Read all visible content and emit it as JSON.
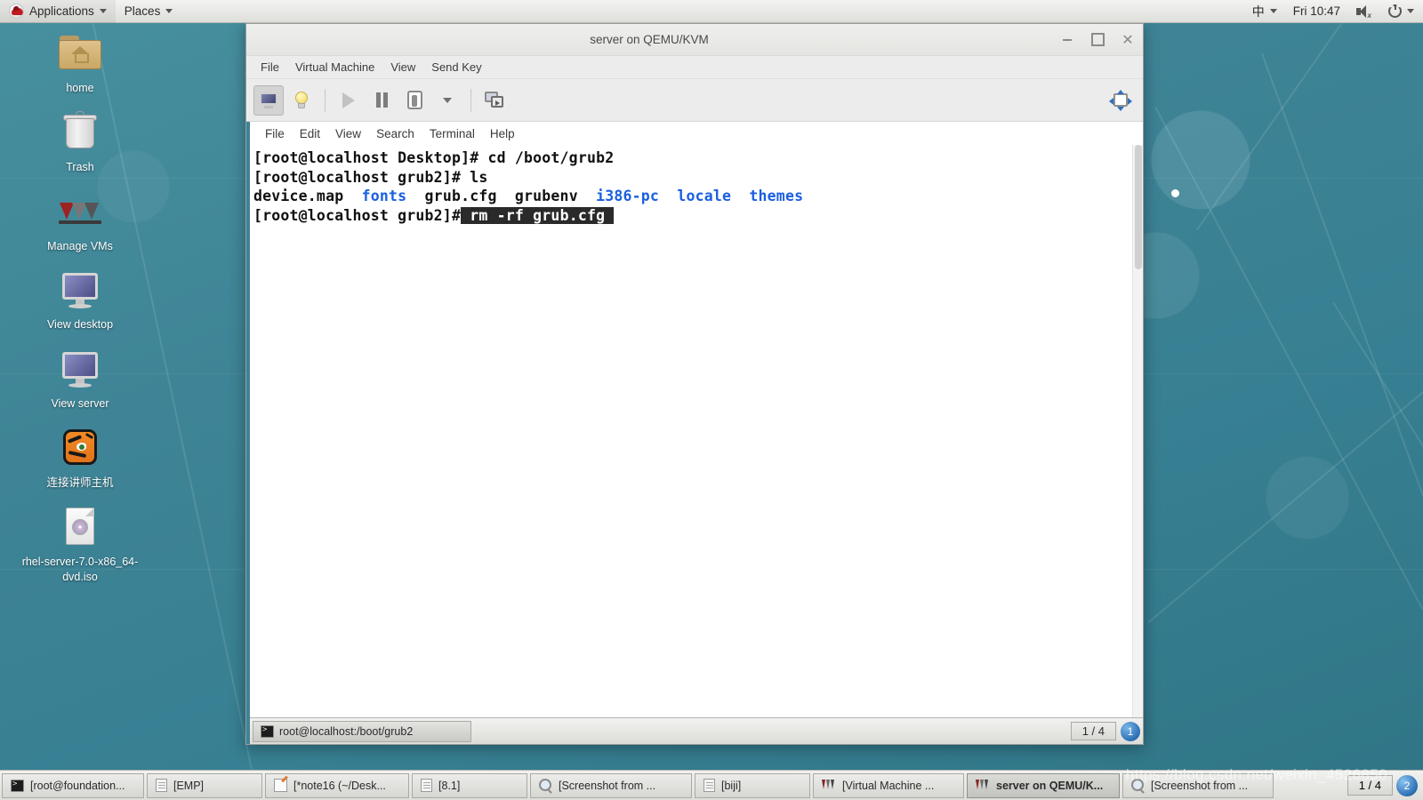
{
  "top_panel": {
    "logo_icon": "redhat-logo-icon",
    "applications_label": "Applications",
    "places_label": "Places",
    "input_method": "中",
    "clock": "Fri 10:47",
    "volume_icon": "volume-muted-icon",
    "power_icon": "power-icon"
  },
  "desktop_icons": [
    {
      "label": "home",
      "icon": "home-folder-icon"
    },
    {
      "label": "Trash",
      "icon": "trash-icon"
    },
    {
      "label": "Manage VMs",
      "icon": "virt-manager-icon"
    },
    {
      "label": "View desktop",
      "icon": "monitor-icon"
    },
    {
      "label": "View server",
      "icon": "monitor-icon"
    },
    {
      "label": "连接讲师主机",
      "icon": "tigervnc-icon"
    },
    {
      "label": "rhel-server-7.0-x86_64-dvd.iso",
      "icon": "iso-disc-icon"
    }
  ],
  "vm_window": {
    "title": "server on QEMU/KVM",
    "window_buttons": {
      "minimize": "_",
      "maximize": "□",
      "close": "✕"
    },
    "menus": [
      "File",
      "Virtual Machine",
      "View",
      "Send Key"
    ],
    "toolbar": [
      {
        "name": "show-console-button",
        "icon": "monitor-icon",
        "state": "active"
      },
      {
        "name": "show-details-button",
        "icon": "lightbulb-icon",
        "state": "enabled"
      },
      {
        "name": "run-button",
        "icon": "play-icon",
        "state": "disabled"
      },
      {
        "name": "pause-button",
        "icon": "pause-icon",
        "state": "enabled"
      },
      {
        "name": "shutdown-button",
        "icon": "shutdown-icon",
        "state": "enabled"
      },
      {
        "name": "shutdown-dropdown",
        "icon": "chevron-down-icon",
        "state": "enabled"
      },
      {
        "name": "snapshots-button",
        "icon": "snapshot-icon",
        "state": "enabled"
      }
    ],
    "fullscreen_icon": "fullscreen-resize-icon"
  },
  "guest": {
    "terminal_menus": [
      "File",
      "Edit",
      "View",
      "Search",
      "Terminal",
      "Help"
    ],
    "lines": [
      [
        {
          "t": "[root@localhost Desktop]# cd /boot/grub2",
          "c": "plain"
        }
      ],
      [
        {
          "t": "[root@localhost grub2]# ls",
          "c": "plain"
        }
      ],
      [
        {
          "t": "device.map  ",
          "c": "plain"
        },
        {
          "t": "fonts",
          "c": "dir"
        },
        {
          "t": "  grub.cfg  grubenv  ",
          "c": "plain"
        },
        {
          "t": "i386-pc",
          "c": "dir"
        },
        {
          "t": "  ",
          "c": "plain"
        },
        {
          "t": "locale",
          "c": "dir"
        },
        {
          "t": "  ",
          "c": "plain"
        },
        {
          "t": "themes",
          "c": "dir"
        }
      ],
      [
        {
          "t": "[root@localhost grub2]#",
          "c": "plain"
        },
        {
          "t": " rm -rf grub.cfg ",
          "c": "sel"
        }
      ]
    ],
    "taskbar": {
      "window_label": "root@localhost:/boot/grub2",
      "window_icon": "terminal-icon",
      "pager": "1 / 4",
      "badge": "1"
    }
  },
  "host_taskbar": {
    "items": [
      {
        "label": "[root@foundation...",
        "icon": "terminal-icon",
        "width": "ht-w1",
        "active": false
      },
      {
        "label": "[EMP]",
        "icon": "document-icon",
        "width": "ht-w2",
        "active": false
      },
      {
        "label": "[*note16 (~/Desk...",
        "icon": "editor-icon",
        "width": "ht-w3",
        "active": false
      },
      {
        "label": "[8.1]",
        "icon": "document-icon",
        "width": "ht-w4",
        "active": false
      },
      {
        "label": "[Screenshot from ...",
        "icon": "screenshot-icon",
        "width": "ht-w5",
        "active": false
      },
      {
        "label": "[biji]",
        "icon": "document-icon",
        "width": "ht-w6",
        "active": false
      },
      {
        "label": "[Virtual Machine ...",
        "icon": "virt-manager-icon",
        "width": "ht-w7",
        "active": false
      },
      {
        "label": "server on QEMU/K...",
        "icon": "virt-manager-icon",
        "width": "ht-w8",
        "active": true
      },
      {
        "label": "[Screenshot from ...",
        "icon": "screenshot-icon",
        "width": "ht-w9",
        "active": false
      }
    ],
    "pager": "1 / 4",
    "badge": "2"
  },
  "watermark": "https://blog.csdn.net/weixin_4526850"
}
